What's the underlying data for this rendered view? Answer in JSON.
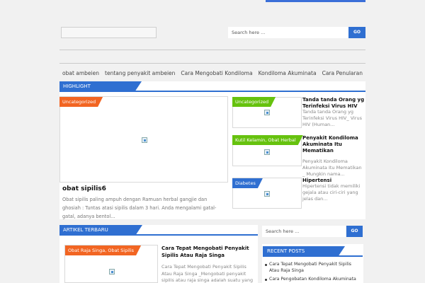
{
  "header": {
    "search_placeholder": "Search here ...",
    "go_label": "GO"
  },
  "nav": {
    "items": [
      "obat ambeien",
      "tentang penyakit ambeien",
      "Cara Mengobati Kondiloma",
      "Kondiloma Akuminata",
      "Cara Penularan"
    ]
  },
  "highlight": {
    "title": "HIGHLIGHT",
    "main": {
      "tag": "Uncategorized",
      "title": "obat sipilis6",
      "excerpt": "Obat sipilis paling ampuh dengan Ramuan herbal gangjie dan ghosiah : Tuntas atasi sipilis dalam 3 hari. Anda mengalami gatal-gatal, adanya bentol..."
    },
    "side": [
      {
        "tag": "Uncategorized",
        "title": "Tanda tanda Orang yg Terinfeksi Virus HIV",
        "excerpt": "Tanda tanda Orang yg Terinfeksi Virus HIV_ Virus HIV (Human..."
      },
      {
        "tag": "Kutil Kelamin, Obat Herbal",
        "title": "Penyakit Kondiloma Akuminata Itu Mematikan",
        "excerpt": "Penyakit Kondiloma Akuminata Itu Mematikan _ Mungkin nama..."
      },
      {
        "tag": "Diabetes",
        "title": "Hipertensi",
        "excerpt": "Hipertensi tidak memiliki gejala atau ciri-ciri yang jelas dan..."
      }
    ]
  },
  "artikel": {
    "title": "ARTIKEL TERBARU",
    "post": {
      "tag": "Obat Raja Singa, Obat Sipilis",
      "title": "Cara Tepat Mengobati Penyakit Sipilis Atau Raja Singa",
      "excerpt": "Cara Tepat Mengobati Penyakit Sipilis Atau Raja Singa _Mengobati penyakit sipilis atau raja singa adalah suatu yang"
    }
  },
  "sidebar": {
    "search_placeholder": "Search here ...",
    "go_label": "GO",
    "recent_title": "RECENT POSTS",
    "recent": [
      "Cara Tepat Mengobati Penyakit Sipilis Atau Raja Singa",
      "Cara Pengobatan Kondiloma Akuminata Pada"
    ]
  },
  "colors": {
    "accent": "#2f6fd1",
    "orange": "#f26522",
    "green": "#66c20e"
  }
}
